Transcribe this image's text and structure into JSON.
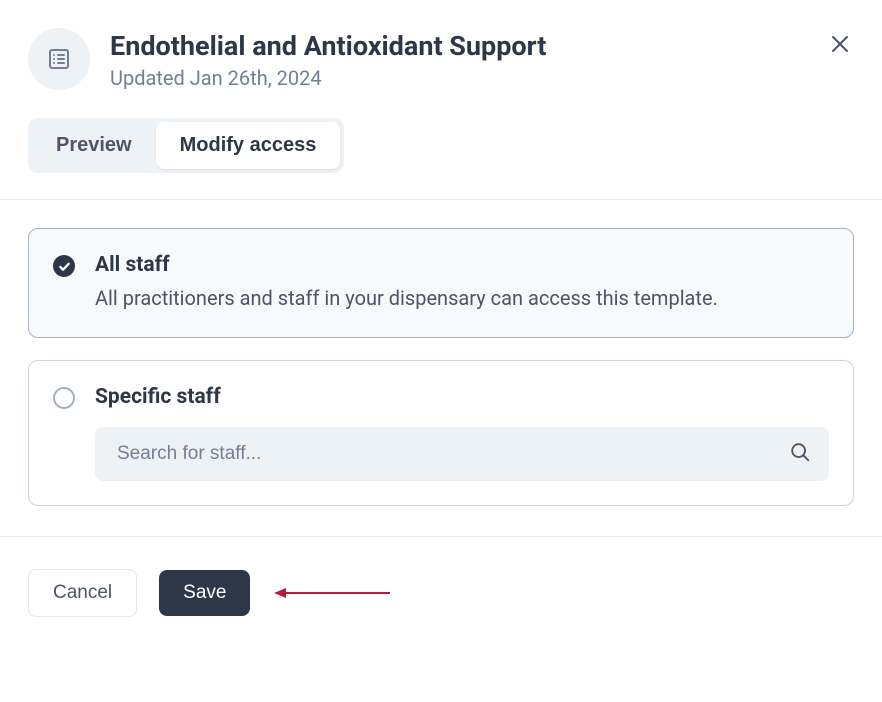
{
  "header": {
    "title": "Endothelial and Antioxidant Support",
    "updated_label": "Updated Jan 26th, 2024"
  },
  "tabs": {
    "preview": "Preview",
    "modify_access": "Modify access"
  },
  "options": {
    "all_staff": {
      "title": "All staff",
      "description": "All practitioners and staff in your dispensary can access this template."
    },
    "specific_staff": {
      "title": "Specific staff",
      "search_placeholder": "Search for staff..."
    }
  },
  "buttons": {
    "cancel": "Cancel",
    "save": "Save"
  },
  "colors": {
    "accent_dark": "#2d3748",
    "arrow_color": "#b91c3a"
  }
}
